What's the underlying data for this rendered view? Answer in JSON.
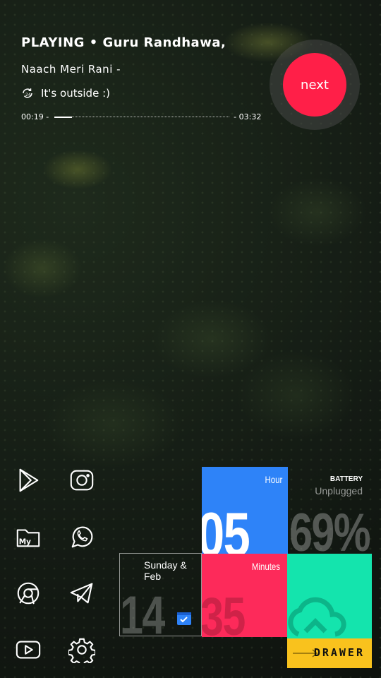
{
  "music": {
    "playing": "PLAYING • Guru Randhawa,",
    "song": "Naach Meri Rani -",
    "weather_text": "It's  outside :)",
    "time_elapsed": "00:19 -",
    "time_total": "- 03:32",
    "progress": 0.1,
    "next_label": "next"
  },
  "apps": [
    {
      "name": "play-store-icon"
    },
    {
      "name": "instagram-icon"
    },
    {
      "name": "my-files-icon"
    },
    {
      "name": "whatsapp-icon"
    },
    {
      "name": "chrome-icon"
    },
    {
      "name": "telegram-icon"
    },
    {
      "name": "youtube-icon"
    },
    {
      "name": "settings-icon"
    }
  ],
  "tiles": {
    "hour_label": "Hour",
    "hour_value": "05",
    "battery_title": "BATTERY",
    "battery_status": "Unplugged",
    "battery_value": "69%",
    "minutes_label": "Minutes",
    "minutes_value": "35",
    "date_label": "Sunday & Feb",
    "day_value": "14",
    "drawer_label": "DRAWER"
  },
  "colors": {
    "accent_red": "#ff1f48",
    "hour_blue": "#2e83f8",
    "minutes_pink": "#fd2a5a",
    "teal": "#14e4ad",
    "drawer_yellow": "#f9c21d"
  }
}
